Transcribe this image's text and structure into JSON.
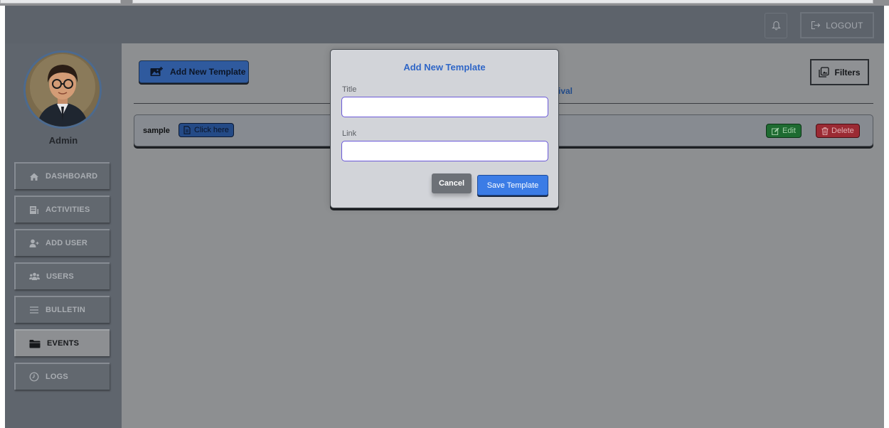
{
  "header": {
    "bell_icon": "bell-icon",
    "logout_label": "LOGOUT",
    "logout_icon": "logout-icon"
  },
  "sidebar": {
    "admin_name": "Admin",
    "items": [
      {
        "label": "DASHBOARD",
        "icon": "home-icon"
      },
      {
        "label": "ACTIVITIES",
        "icon": "activities-icon"
      },
      {
        "label": "ADD USER",
        "icon": "add-user-icon"
      },
      {
        "label": "USERS",
        "icon": "users-icon"
      },
      {
        "label": "BULLETIN",
        "icon": "menu-icon"
      },
      {
        "label": "EVENTS",
        "icon": "folder-icon",
        "active": true
      },
      {
        "label": "LOGS",
        "icon": "clock-icon"
      }
    ]
  },
  "main": {
    "add_template_label": "Add New Template",
    "filters_label": "Filters",
    "tab_label_partial": "ival",
    "templates": [
      {
        "name": "sample",
        "link_label": "Click here",
        "edit_label": "Edit",
        "delete_label": "Delete"
      }
    ]
  },
  "modal": {
    "title": "Add New Template",
    "title_field_label": "Title",
    "title_value": "",
    "link_field_label": "Link",
    "link_value": "",
    "cancel_label": "Cancel",
    "save_label": "Save Template"
  },
  "colors": {
    "header_bg": "#5d636b",
    "sidebar_bg": "#5f656d",
    "overlay_bg": "#8d8f91",
    "accent_blue": "#3b7ce6",
    "edit_green": "#1e6b31",
    "delete_red": "#9b2a33"
  }
}
